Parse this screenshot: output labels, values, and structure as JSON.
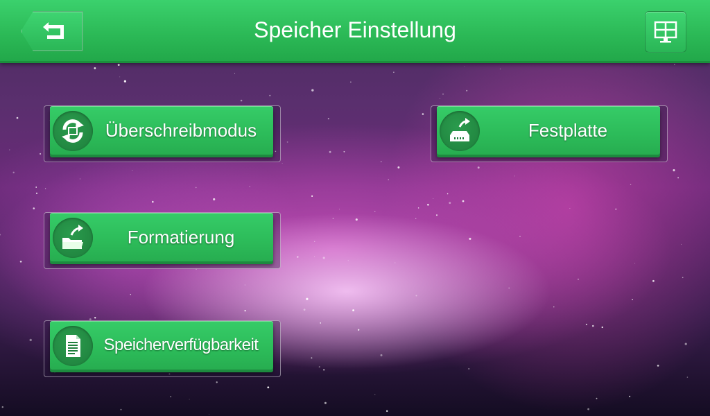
{
  "header": {
    "title": "Speicher Einstellung",
    "back_icon": "back-arrow-icon",
    "menu_icon": "grid-monitor-icon"
  },
  "tiles": [
    {
      "id": "overwrite",
      "label": "Überschreibmodus",
      "icon": "refresh-cycle-icon"
    },
    {
      "id": "harddisk",
      "label": "Festplatte",
      "icon": "hard-disk-icon"
    },
    {
      "id": "format",
      "label": "Formatierung",
      "icon": "folder-arrow-icon"
    },
    {
      "id": "availability",
      "label": "Speicherverfügbarkeit",
      "icon": "document-icon"
    }
  ],
  "colors": {
    "accent_green": "#2cbb59",
    "accent_dark_green": "#1e7f3c",
    "text": "#ffffff"
  }
}
